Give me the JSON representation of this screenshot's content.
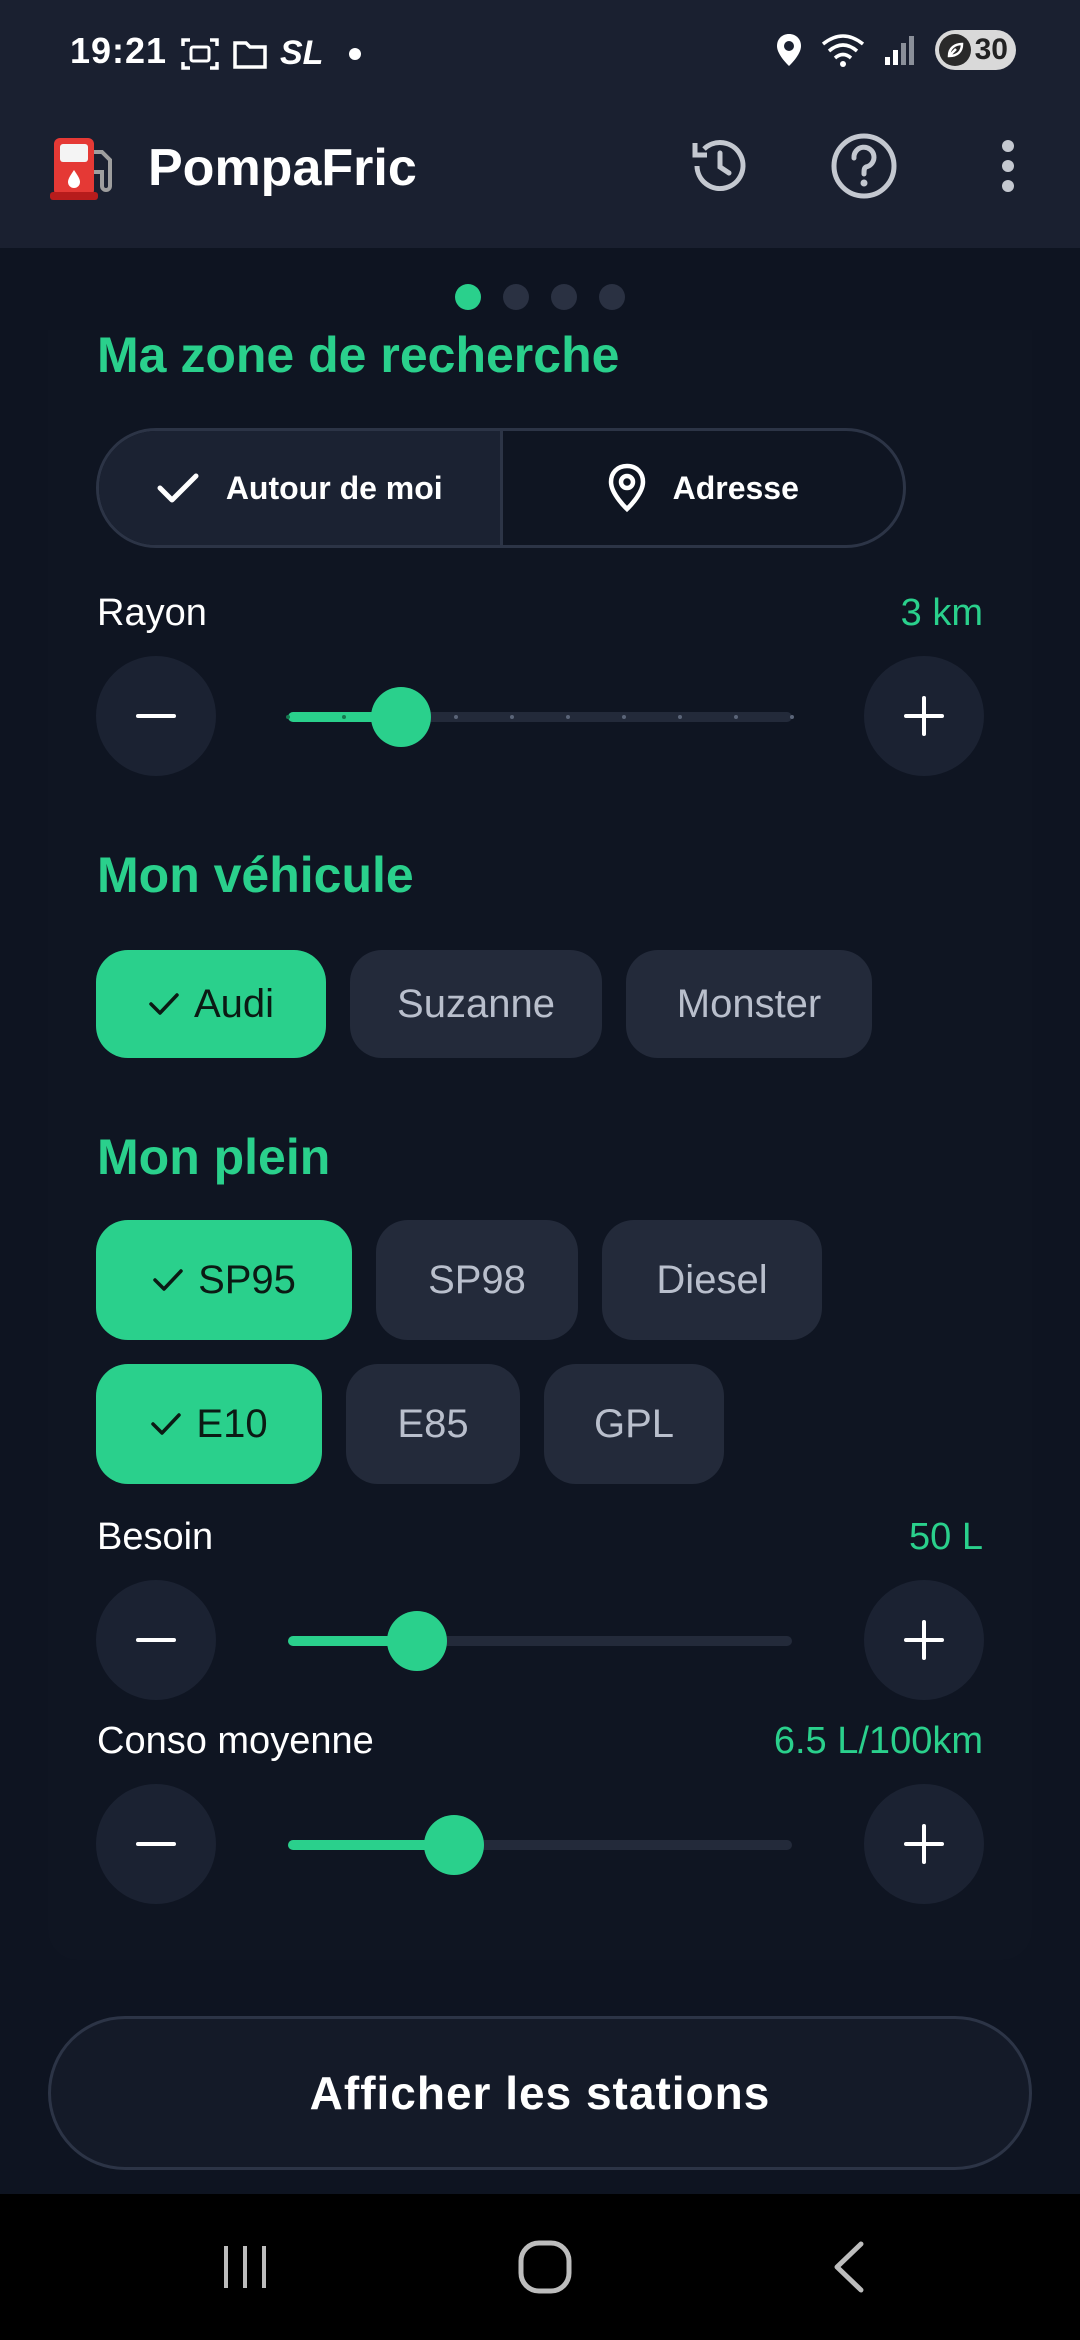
{
  "status_bar": {
    "time": "19:21",
    "carrier_tag": "SL",
    "battery_level": "30"
  },
  "app_bar": {
    "title": "PompaFric"
  },
  "pager": {
    "count": 4,
    "active_index": 0
  },
  "search_zone": {
    "title": "Ma zone de recherche",
    "options": [
      {
        "label": "Autour de moi",
        "selected": true
      },
      {
        "label": "Adresse",
        "selected": false
      }
    ],
    "radius": {
      "label": "Rayon",
      "value_text": "3 km",
      "value": 3,
      "min": 1,
      "max": 10
    }
  },
  "vehicle": {
    "title": "Mon véhicule",
    "chips": [
      {
        "label": "Audi",
        "selected": true
      },
      {
        "label": "Suzanne",
        "selected": false
      },
      {
        "label": "Monster",
        "selected": false
      }
    ]
  },
  "fuel": {
    "title": "Mon plein",
    "chips_row1": [
      {
        "label": "SP95",
        "selected": true
      },
      {
        "label": "SP98",
        "selected": false
      },
      {
        "label": "Diesel",
        "selected": false
      }
    ],
    "chips_row2": [
      {
        "label": "E10",
        "selected": true
      },
      {
        "label": "E85",
        "selected": false
      },
      {
        "label": "GPL",
        "selected": false
      }
    ],
    "need": {
      "label": "Besoin",
      "value_text": "50 L",
      "fill_fraction": 0.255
    },
    "consumption": {
      "label": "Conso moyenne",
      "value_text": "6.5 L/100km",
      "fill_fraction": 0.33
    }
  },
  "cta": {
    "label": "Afficher les stations"
  },
  "colors": {
    "accent": "#2ad08c",
    "background": "#0e1421",
    "bar": "#1a2030"
  }
}
